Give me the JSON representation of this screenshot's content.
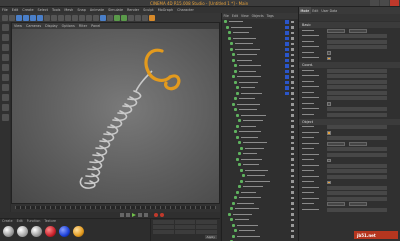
{
  "window": {
    "title": "CINEMA 4D R15.008 Studio - [Untitled 1 *] - Main",
    "controls": [
      "minimize",
      "maximize",
      "close"
    ]
  },
  "menubar": {
    "items": [
      "File",
      "Edit",
      "Create",
      "Select",
      "Tools",
      "Mesh",
      "Snap",
      "Animate",
      "Simulate",
      "Render",
      "Sculpt",
      "MoGraph",
      "Character",
      "Plugins",
      "Script",
      "Window",
      "Help"
    ]
  },
  "toolbar": {
    "icons": [
      "undo-icon",
      "redo-icon",
      "live-select-icon",
      "move-icon",
      "scale-icon",
      "rotate-icon",
      "recent-icon",
      "x-axis-icon",
      "y-axis-icon",
      "z-axis-icon",
      "coordinate-icon",
      "render-view-icon",
      "render-pv-icon",
      "render-settings-icon",
      "cube-icon",
      "spline-pen-icon",
      "subdivision-icon",
      "array-icon",
      "deformer-icon",
      "floor-icon",
      "camera-icon",
      "light-icon"
    ]
  },
  "viewport": {
    "menu": [
      "View",
      "Cameras",
      "Display",
      "Options",
      "Filter",
      "Panel"
    ],
    "colors": {
      "spring": "#c9c9c9",
      "hook": "#e39a1d"
    }
  },
  "timeline": {
    "ticks": [
      "0",
      "10",
      "20",
      "30",
      "40",
      "50",
      "60",
      "70",
      "80",
      "90"
    ]
  },
  "materials": {
    "tabs": [
      "Create",
      "Edit",
      "Function",
      "Texture"
    ],
    "swatches": [
      "#c8c8c8",
      "#e0e0e0",
      "#d8d8d8",
      "#c8202a",
      "#1a3fd8",
      "#e39a1d"
    ]
  },
  "coordinates": {
    "apply_label": "Apply"
  },
  "object_manager": {
    "menu": [
      "File",
      "Edit",
      "View",
      "Objects",
      "Tags",
      "Bookmarks"
    ]
  },
  "attributes": {
    "tabs": [
      "Mode",
      "Edit",
      "User Data"
    ],
    "header": "",
    "sections": [
      "Basic",
      "Coord.",
      "Object"
    ]
  },
  "logo": {
    "text": "jb51.net"
  }
}
